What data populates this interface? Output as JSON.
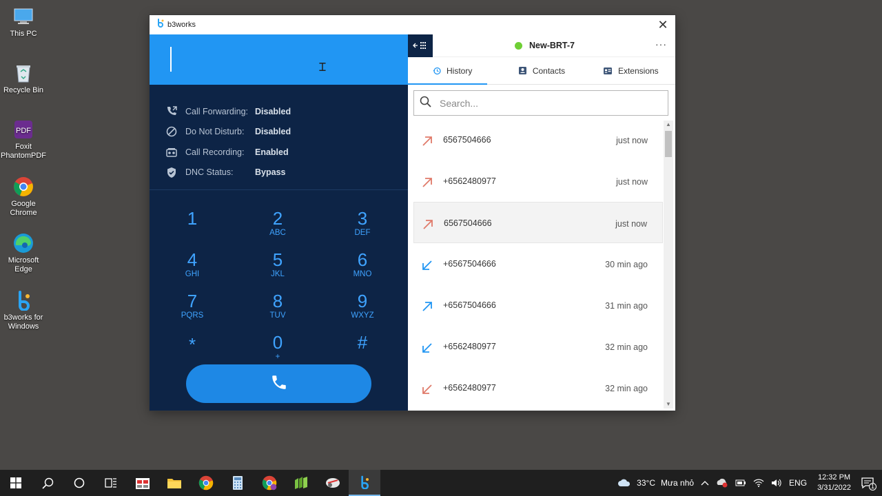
{
  "desktop": {
    "icons": [
      {
        "label": "This PC"
      },
      {
        "label": "Recycle Bin"
      },
      {
        "label": "Foxit PhantomPDF"
      },
      {
        "label": "Google Chrome"
      },
      {
        "label": "Microsoft Edge"
      },
      {
        "label": "b3works for Windows"
      }
    ]
  },
  "window": {
    "title": "b3works",
    "close_label": "✕"
  },
  "dialer": {
    "status": [
      {
        "label": "Call Forwarding:",
        "value": "Disabled",
        "icon": "call-forward-icon"
      },
      {
        "label": "Do Not Disturb:",
        "value": "Disabled",
        "icon": "block-icon"
      },
      {
        "label": "Call Recording:",
        "value": "Enabled",
        "icon": "recording-icon"
      },
      {
        "label": "DNC Status:",
        "value": "Bypass",
        "icon": "shield-check-icon"
      }
    ],
    "keys": [
      {
        "num": "1",
        "letters": ""
      },
      {
        "num": "2",
        "letters": "ABC"
      },
      {
        "num": "3",
        "letters": "DEF"
      },
      {
        "num": "4",
        "letters": "GHI"
      },
      {
        "num": "5",
        "letters": "JKL"
      },
      {
        "num": "6",
        "letters": "MNO"
      },
      {
        "num": "7",
        "letters": "PQRS"
      },
      {
        "num": "8",
        "letters": "TUV"
      },
      {
        "num": "9",
        "letters": "WXYZ"
      },
      {
        "num": "*",
        "letters": ""
      },
      {
        "num": "0",
        "letters": "+"
      },
      {
        "num": "#",
        "letters": ""
      }
    ]
  },
  "header": {
    "extension_name": "New-BRT-7",
    "status_color": "#6fcf35",
    "more_label": "···"
  },
  "tabs": [
    {
      "label": "History",
      "icon": "history-icon"
    },
    {
      "label": "Contacts",
      "icon": "contacts-icon"
    },
    {
      "label": "Extensions",
      "icon": "extensions-icon"
    }
  ],
  "search": {
    "placeholder": "Search..."
  },
  "history": [
    {
      "number": "6567504666",
      "time": "just now",
      "direction": "outgoing-missed",
      "color": "#e07a6a"
    },
    {
      "number": "+6562480977",
      "time": "just now",
      "direction": "outgoing-missed",
      "color": "#e07a6a"
    },
    {
      "number": "6567504666",
      "time": "just now",
      "direction": "outgoing-missed",
      "color": "#e07a6a"
    },
    {
      "number": "+6567504666",
      "time": "30 min ago",
      "direction": "incoming",
      "color": "#2196f3"
    },
    {
      "number": "+6567504666",
      "time": "31 min ago",
      "direction": "outgoing",
      "color": "#2196f3"
    },
    {
      "number": "+6562480977",
      "time": "32 min ago",
      "direction": "incoming",
      "color": "#2196f3"
    },
    {
      "number": "+6562480977",
      "time": "32 min ago",
      "direction": "incoming-missed",
      "color": "#e07a6a"
    }
  ],
  "taskbar": {
    "weather_temp": "33°C",
    "weather_desc": "Mưa nhỏ",
    "language": "ENG",
    "time": "12:32 PM",
    "date": "3/31/2022",
    "notification_count": "1"
  }
}
